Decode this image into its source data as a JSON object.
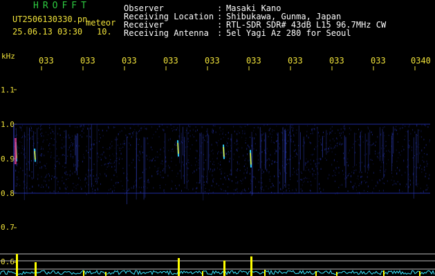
{
  "header": {
    "brand": "HROFFT",
    "filename": "UT2506130330.pn",
    "tag": "meteor",
    "datetime": "25.06.13 03:30",
    "interval": "10.",
    "info": [
      {
        "label": "Observer",
        "sep": ":",
        "value": "Masaki Kano"
      },
      {
        "label": "Receiving Location",
        "sep": ":",
        "value": "Shibukawa, Gunma, Japan"
      },
      {
        "label": "Receiver",
        "sep": ":",
        "value": "RTL-SDR SDR# 43dB L15 96.7MHz CW"
      },
      {
        "label": "Receiving Antenna",
        "sep": ":",
        "value": "5el Yagi Az 280 for Seoul"
      }
    ]
  },
  "axis": {
    "y_unit": "kHz",
    "y_ticks": [
      "1.1",
      "1.0",
      "0.9",
      "0.8",
      "0.7",
      "0.6"
    ],
    "x_ticks": [
      "033",
      "033",
      "033",
      "033",
      "033",
      "033",
      "033",
      "033",
      "033",
      "0340"
    ]
  },
  "colors": {
    "background": "#000000",
    "axis_text": "#f0e23a",
    "brand": "#2ecc40",
    "noise_band": "#1e2a9a",
    "meteor_trace": "#e8f040",
    "level_trace": "#39e6ff",
    "level_peak": "#ffff00"
  },
  "chart_data": {
    "type": "heatmap",
    "title": "",
    "ylabel": "kHz",
    "ylim": [
      0.58,
      1.16
    ],
    "band_khz": [
      0.8,
      1.0
    ],
    "meteor_echoes": [
      {
        "minute": 0.05,
        "khz": 0.92,
        "strength": 1.0
      },
      {
        "minute": 0.5,
        "khz": 0.91,
        "strength": 0.5
      },
      {
        "minute": 3.95,
        "khz": 0.93,
        "strength": 0.75
      },
      {
        "minute": 5.05,
        "khz": 0.92,
        "strength": 0.6
      },
      {
        "minute": 5.7,
        "khz": 0.9,
        "strength": 0.85
      }
    ]
  }
}
